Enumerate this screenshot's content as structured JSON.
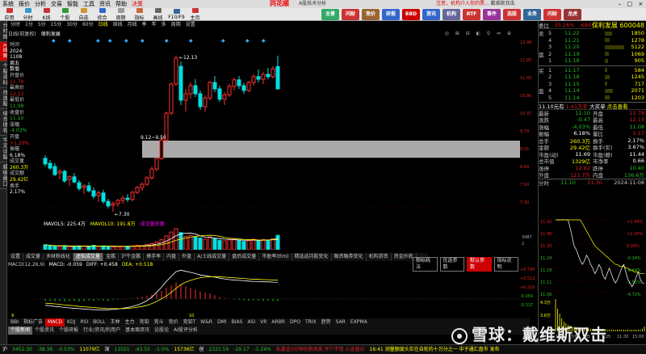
{
  "menu": {
    "items": [
      "系统",
      "报价",
      "分析",
      "交易",
      "智能",
      "工具",
      "资讯",
      "帮助",
      "决策"
    ],
    "brand": "同花顺",
    "subtitle": "A股技术分析",
    "notice": "注意，机构介入你的票...",
    "notice2": "戴维斯双击"
  },
  "toolbar": {
    "buttons": [
      "应用",
      "分时",
      "K线",
      "个股",
      "自选",
      "综合",
      "周期",
      "指标",
      "画线",
      "F10/F9",
      "主页",
      "全景",
      "问财",
      "竞价",
      "研报",
      "BBD",
      "资讯",
      "机构",
      "RTF",
      "事件",
      "选股",
      "业务",
      "问财",
      "龙虎"
    ],
    "colors": [
      "#c33",
      "#39c",
      "#c33",
      "#393",
      "#c93",
      "#36c",
      "#999",
      "#c63",
      "#666",
      "#369",
      "#c33",
      "#3a6",
      "#c33",
      "#963",
      "#36c",
      "#c00",
      "#36c",
      "#669",
      "#c33",
      "#939",
      "#c33",
      "#369",
      "#c33",
      "#933"
    ]
  },
  "left_tabs": [
    "分时图",
    "K线图",
    "个股资料",
    "自选股",
    "综合排名",
    "牛叉诊股",
    "超级盘口"
  ],
  "period": {
    "items": [
      "分时",
      "1分",
      "5分",
      "15分",
      "30分",
      "60分",
      "日线",
      "周线",
      "月线",
      "季",
      "年",
      "多",
      "周期",
      "设置"
    ],
    "selected": "日线"
  },
  "info_header": {
    "left": "日线(前复权)",
    "name": "保利发展"
  },
  "side_panel": [
    {
      "label": "时间",
      "value": "2024",
      "cls": "vw"
    },
    {
      "label": "",
      "value": "1108",
      "cls": "vw"
    },
    {
      "label": "",
      "value": "周五",
      "cls": "vw"
    },
    {
      "label": "",
      "value": "数值",
      "cls": "vw"
    },
    {
      "label": "开盘价",
      "value": "11.79",
      "cls": "vr"
    },
    {
      "label": "最高价",
      "value": "12.13",
      "cls": "vr"
    },
    {
      "label": "最低价",
      "value": "11.08",
      "cls": "vg"
    },
    {
      "label": "收盘价",
      "value": "11.10",
      "cls": "vg"
    },
    {
      "label": "涨幅",
      "value": "-4.03%",
      "cls": "vg"
    },
    {
      "label": "开盘",
      "value": "+1.20%",
      "cls": "vr"
    },
    {
      "label": "振幅",
      "value": "6.18%",
      "cls": "vw"
    },
    {
      "label": "成交量",
      "value": "260.3万",
      "cls": "vy"
    },
    {
      "label": "成交额",
      "value": "29.42亿",
      "cls": "vy"
    },
    {
      "label": "换手",
      "value": "2.17%",
      "cls": "vw"
    }
  ],
  "kline": {
    "price_labels": [
      "12.46",
      "11.85",
      "11.43",
      "10.86",
      "10.37",
      "9.79",
      "9.35",
      "8.69",
      "7.99",
      "7.30"
    ],
    "high_mark": "12.13",
    "low_mark": "7.30",
    "band_label": "9.12~9.50",
    "ohlc": [
      [
        8.95,
        9.05,
        8.7,
        8.78
      ],
      [
        8.8,
        8.9,
        8.6,
        8.65
      ],
      [
        8.7,
        8.8,
        8.4,
        8.45
      ],
      [
        8.5,
        8.62,
        8.3,
        8.55
      ],
      [
        8.55,
        8.6,
        8.2,
        8.25
      ],
      [
        8.3,
        8.42,
        8.1,
        8.38
      ],
      [
        8.38,
        8.5,
        8.18,
        8.22
      ],
      [
        8.2,
        8.28,
        7.95,
        8.02
      ],
      [
        8.05,
        8.15,
        7.85,
        8.1
      ],
      [
        8.1,
        8.22,
        7.9,
        7.95
      ],
      [
        7.95,
        8.05,
        7.7,
        7.78
      ],
      [
        7.8,
        7.95,
        7.6,
        7.88
      ],
      [
        7.88,
        7.98,
        7.55,
        7.62
      ],
      [
        7.62,
        7.7,
        7.4,
        7.48
      ],
      [
        7.5,
        7.62,
        7.3,
        7.55
      ],
      [
        7.55,
        7.7,
        7.45,
        7.65
      ],
      [
        7.65,
        7.8,
        7.55,
        7.72
      ],
      [
        7.72,
        7.85,
        7.6,
        7.68
      ],
      [
        7.68,
        7.95,
        7.62,
        7.9
      ],
      [
        7.9,
        8.1,
        7.85,
        8.05
      ],
      [
        8.05,
        8.2,
        7.95,
        8.15
      ],
      [
        8.15,
        8.4,
        8.1,
        8.35
      ],
      [
        8.35,
        8.7,
        8.3,
        8.62
      ],
      [
        8.62,
        9.0,
        8.55,
        8.95
      ],
      [
        8.95,
        9.6,
        8.9,
        9.52
      ],
      [
        9.52,
        10.4,
        9.45,
        10.35
      ],
      [
        10.35,
        11.3,
        10.3,
        11.25
      ],
      [
        11.25,
        12.13,
        11.2,
        12.05
      ],
      [
        11.8,
        11.95,
        10.6,
        10.75
      ],
      [
        10.75,
        11.1,
        10.4,
        10.95
      ],
      [
        10.95,
        11.3,
        10.8,
        11.2
      ],
      [
        11.2,
        11.4,
        10.85,
        10.95
      ],
      [
        10.95,
        11.05,
        10.45,
        10.55
      ],
      [
        10.55,
        10.9,
        10.4,
        10.82
      ],
      [
        10.82,
        11.35,
        10.75,
        11.3
      ],
      [
        11.3,
        11.5,
        11.0,
        11.1
      ],
      [
        11.1,
        11.2,
        10.7,
        10.78
      ],
      [
        10.78,
        11.0,
        10.6,
        10.92
      ],
      [
        10.92,
        11.25,
        10.85,
        11.18
      ],
      [
        11.18,
        11.45,
        11.05,
        11.38
      ],
      [
        11.38,
        11.5,
        11.1,
        11.2
      ],
      [
        11.2,
        11.28,
        10.95,
        11.05
      ],
      [
        11.05,
        11.35,
        11.0,
        11.3
      ],
      [
        11.3,
        11.55,
        11.2,
        11.48
      ],
      [
        11.48,
        11.7,
        11.3,
        11.4
      ],
      [
        11.4,
        11.62,
        11.25,
        11.55
      ],
      [
        11.55,
        11.75,
        11.4,
        11.48
      ],
      [
        11.48,
        11.8,
        11.42,
        11.72
      ],
      [
        11.79,
        12.13,
        11.08,
        11.1
      ]
    ]
  },
  "volume": {
    "header": [
      "MAVOL5: 225.4万",
      "MAVOL10: 191.8万",
      "成交量放量"
    ],
    "labels": [
      "3487",
      "2"
    ],
    "values": [
      90,
      70,
      65,
      60,
      75,
      55,
      60,
      70,
      65,
      55,
      80,
      60,
      70,
      65,
      50,
      55,
      60,
      65,
      70,
      80,
      75,
      95,
      110,
      140,
      180,
      250,
      320,
      380,
      310,
      240,
      260,
      230,
      210,
      190,
      230,
      200,
      170,
      160,
      180,
      200,
      175,
      150,
      165,
      190,
      170,
      185,
      175,
      200,
      260
    ]
  },
  "y_tabs": [
    "设置",
    "成交量",
    "多财粉线化",
    "虚拟成交量",
    "金鹏",
    "沪牛金鹏",
    "摸手率",
    "内盘",
    "外盘",
    "A/土线成交量",
    "盘后成交量",
    "市盈率(ttm)",
    "精选选持股变化",
    "融资融券变化",
    "机构游资",
    "资金抄底"
  ],
  "y_tabs_selected": "虚拟成交量",
  "buttons": [
    "指标线法",
    "优选参数",
    "默认参数",
    "指标说明"
  ],
  "buttons_selected": "默认参数",
  "macd": {
    "header": [
      "MACD(12,26,9)",
      "MACD: -0.059",
      "DIFF: +0.458",
      "DEA: +0.518"
    ],
    "labels": [
      "+0.795",
      "+0.512",
      "+0.229",
      "-0.054",
      "-0.337"
    ],
    "hist": [
      -0.05,
      -0.06,
      -0.07,
      -0.06,
      -0.08,
      -0.07,
      -0.06,
      -0.08,
      -0.07,
      -0.05,
      -0.06,
      -0.04,
      -0.05,
      -0.06,
      -0.03,
      -0.02,
      -0.01,
      0.01,
      0.02,
      0.04,
      0.06,
      0.09,
      0.12,
      0.16,
      0.22,
      0.3,
      0.38,
      0.45,
      0.4,
      0.35,
      0.3,
      0.26,
      0.2,
      0.17,
      0.15,
      0.1,
      0.05,
      0.02,
      0.0,
      -0.02,
      -0.03,
      -0.04,
      -0.05,
      -0.04,
      -0.05,
      -0.06,
      -0.05,
      -0.06,
      -0.06
    ],
    "diff": [
      -0.18,
      -0.19,
      -0.21,
      -0.22,
      -0.24,
      -0.25,
      -0.26,
      -0.27,
      -0.28,
      -0.29,
      -0.3,
      -0.3,
      -0.31,
      -0.3,
      -0.29,
      -0.28,
      -0.26,
      -0.24,
      -0.21,
      -0.17,
      -0.12,
      -0.05,
      0.05,
      0.18,
      0.32,
      0.48,
      0.62,
      0.75,
      0.79,
      0.76,
      0.73,
      0.7,
      0.66,
      0.64,
      0.62,
      0.6,
      0.57,
      0.55,
      0.53,
      0.52,
      0.51,
      0.5,
      0.49,
      0.48,
      0.48,
      0.47,
      0.47,
      0.46,
      0.458
    ],
    "dea": [
      -0.12,
      -0.13,
      -0.14,
      -0.15,
      -0.17,
      -0.18,
      -0.19,
      -0.21,
      -0.22,
      -0.23,
      -0.24,
      -0.25,
      -0.26,
      -0.27,
      -0.27,
      -0.27,
      -0.27,
      -0.26,
      -0.25,
      -0.23,
      -0.21,
      -0.18,
      -0.13,
      -0.07,
      0.0,
      0.08,
      0.18,
      0.29,
      0.39,
      0.46,
      0.51,
      0.55,
      0.58,
      0.6,
      0.61,
      0.61,
      0.61,
      0.6,
      0.59,
      0.58,
      0.57,
      0.56,
      0.55,
      0.54,
      0.54,
      0.53,
      0.53,
      0.52,
      0.518
    ]
  },
  "indicator_tabs": [
    "BBI",
    "指标广告",
    "MACD",
    "KDJ",
    "RSI",
    "BOLL",
    "王林",
    "主力",
    "竞铂",
    "竞斗",
    "竞价",
    "竞铂T",
    "W&R",
    "DMI",
    "BIAS",
    "ASI",
    "VR",
    "ARBR",
    "DPO",
    "TRIX",
    "趋势",
    "SAR",
    "EXPMA"
  ],
  "indicator_selected": "MACD",
  "news_tabs": [
    "个股新闻",
    "个股资讯",
    "个股研报",
    "行业/资讯/利用户",
    "基本面资讯",
    "论股论",
    "AI股评分析"
  ],
  "news_selected": "个股新闻",
  "right_panel": {
    "wb_label": "委比",
    "wb_value": "-33.16%",
    "wc": "-6843",
    "name": "保利发展",
    "code": "600048",
    "sell": [
      {
        "l": "卖",
        "n": "5",
        "p": "11.22",
        "v": "1850"
      },
      {
        "l": "",
        "n": "4",
        "p": "11.21",
        "v": "1278"
      },
      {
        "l": "",
        "n": "3",
        "p": "11.20",
        "v": "5122"
      },
      {
        "l": "盘",
        "n": "2",
        "p": "11.19",
        "v": "1069"
      },
      {
        "l": "",
        "n": "1",
        "p": "11.18",
        "v": "905"
      }
    ],
    "buy": [
      {
        "l": "买",
        "n": "1",
        "p": "11.17",
        "v": "584"
      },
      {
        "l": "",
        "n": "2",
        "p": "11.16",
        "v": "1245"
      },
      {
        "l": "",
        "n": "3",
        "p": "11.15",
        "v": "717"
      },
      {
        "l": "盘",
        "n": "4",
        "p": "11.14",
        "v": "2071"
      },
      {
        "l": "",
        "n": "5",
        "p": "11.14",
        "v": "1203"
      }
    ],
    "line1": "11.10元有",
    "line1b": "1.41万手",
    "line1c": "大买单",
    "line1d": "点击查看",
    "stats": [
      {
        "a": "最新",
        "av": "11.10",
        "ac": "grn",
        "b": "开盘",
        "bv": "11.79",
        "bc": "red"
      },
      {
        "a": "涨跌",
        "av": "-0.47",
        "ac": "grn",
        "b": "最高",
        "bv": "12.13",
        "bc": "red"
      },
      {
        "a": "涨幅",
        "av": "-4.03%",
        "ac": "grn",
        "b": "最低",
        "bv": "11.08",
        "bc": "grn"
      },
      {
        "a": "振幅",
        "av": "6.18%",
        "ac": "wht",
        "b": "量比",
        "bv": "1.17",
        "bc": "red"
      },
      {
        "a": "总手",
        "av": "260.3万",
        "ac": "yel",
        "b": "换手",
        "bv": "2.17%",
        "bc": "wht"
      },
      {
        "a": "金额",
        "av": "29.42亿",
        "ac": "yel",
        "b": "换手(实)",
        "bv": "3.67%",
        "bc": "wht"
      },
      {
        "a": "市盈(动)",
        "av": "11.69",
        "ac": "wht",
        "b": "市盈(静)",
        "bv": "11.44",
        "bc": "wht"
      },
      {
        "a": "总市值",
        "av": "1329亿",
        "ac": "yel",
        "b": "市净率",
        "bv": "0.66",
        "bc": "wht"
      },
      {
        "a": "涨停",
        "av": "12.82",
        "ac": "red",
        "b": "跌停",
        "bv": "10.40",
        "bc": "grn"
      },
      {
        "a": "外盘",
        "av": "123.7万",
        "ac": "red",
        "b": "内盘",
        "bv": "136.6万",
        "bc": "grn"
      }
    ],
    "tick_header": [
      "分时",
      "11.10",
      "11.30",
      "2024-11-08"
    ],
    "tick_prices": [
      "11.42",
      "11.36",
      "11.30",
      "11.24",
      "11.18",
      "11.11",
      "11.06"
    ],
    "tick_pcts": [
      "+1.44%",
      "+1.20%",
      "0.00%",
      "-0.24%",
      "-0.44%",
      "-1.51%",
      "-4.72%"
    ],
    "tick_vol_labels": [
      "4.3万",
      "3.6万"
    ],
    "bottom_row": [
      "万",
      "分钟",
      "分时",
      "日",
      "9:25",
      "11:30",
      "15:00"
    ],
    "tick_prices_series": [
      11.79,
      11.95,
      12.05,
      11.9,
      11.7,
      11.55,
      11.48,
      11.4,
      11.35,
      11.3,
      11.28,
      11.25,
      11.22,
      11.2,
      11.22,
      11.25,
      11.23,
      11.2,
      11.18,
      11.15,
      11.17,
      11.2,
      11.18,
      11.14,
      11.12,
      11.15,
      11.18,
      11.15,
      11.12,
      11.1,
      11.12,
      11.15,
      11.18,
      11.2,
      11.16,
      11.12,
      11.1,
      11.08,
      11.1,
      11.13,
      11.16,
      11.12,
      11.1,
      11.1
    ],
    "tick_avg_series": [
      11.79,
      11.85,
      11.9,
      11.88,
      11.82,
      11.76,
      11.7,
      11.65,
      11.6,
      11.55,
      11.52,
      11.48,
      11.45,
      11.42,
      11.4,
      11.38,
      11.36,
      11.34,
      11.32,
      11.3,
      11.29,
      11.28,
      11.27,
      11.26,
      11.25,
      11.24,
      11.23,
      11.22,
      11.21,
      11.2,
      11.2,
      11.19,
      11.19,
      11.19,
      11.18,
      11.18,
      11.17,
      11.17,
      11.16,
      11.16,
      11.16,
      11.15,
      11.15,
      11.15
    ],
    "tick_vol_series": [
      100,
      70,
      55,
      40,
      30,
      25,
      20,
      18,
      15,
      14,
      12,
      12,
      10,
      10,
      9,
      9,
      8,
      8,
      8,
      7,
      7,
      7,
      6,
      6,
      7,
      6,
      6,
      6,
      5,
      5,
      6,
      6,
      5,
      5,
      5,
      6,
      5,
      5,
      5,
      5,
      6,
      5,
      8,
      15
    ]
  },
  "status": {
    "items": [
      {
        "t": "沪",
        "c": "wht"
      },
      {
        "t": "3452.30",
        "c": "grn"
      },
      {
        "t": "-38.36",
        "c": "grn"
      },
      {
        "t": "-0.53%",
        "c": "grn"
      },
      {
        "t": "11079亿",
        "c": "yel"
      },
      {
        "t": "深",
        "c": "wht"
      },
      {
        "t": "11021",
        "c": "grn"
      },
      {
        "t": "-43.55",
        "c": "grn"
      },
      {
        "t": "-1.0%",
        "c": "grn"
      },
      {
        "t": "15736亿",
        "c": "yel"
      },
      {
        "t": "创",
        "c": "wht"
      },
      {
        "t": "2321.59",
        "c": "grn"
      },
      {
        "t": "-29.17",
        "c": "grn"
      },
      {
        "t": "-1.24%",
        "c": "grn"
      }
    ],
    "ticker": "16:41 测量额度头实在自轮的十万分之一 中子通汇盘市 发布",
    "ticker2": "支持地区生活在正主生中国中资高货单",
    "ticker3": "私募金3分钟创新改革 开户不用 入选营业",
    "right": "注册|名称|分时|1\nInternet"
  },
  "watermark": "雪球：戴维斯双击"
}
